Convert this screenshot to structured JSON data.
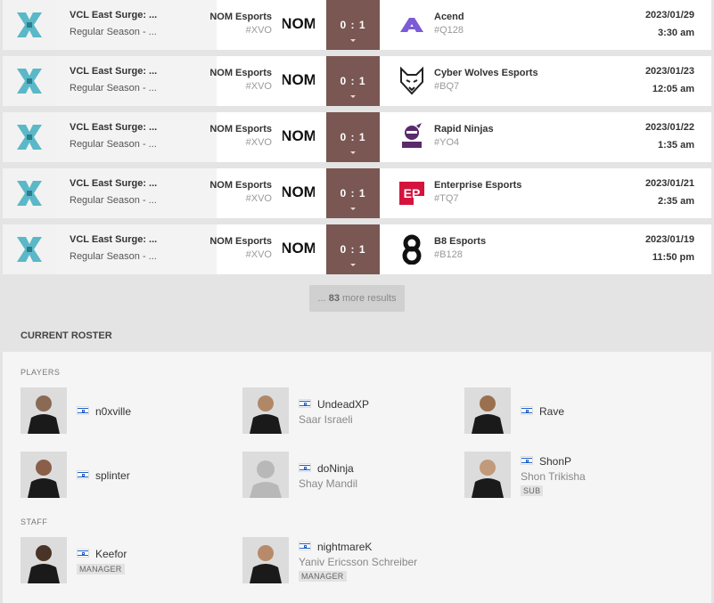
{
  "matches": [
    {
      "event": "VCL East Surge: ...",
      "stage": "Regular Season - ...",
      "team1": "NOM Esports",
      "team1_tag": "#XVO",
      "score": "0 : 1",
      "team2": "Acend",
      "team2_tag": "#Q128",
      "team2_logo": "acend-logo",
      "date": "2023/01/29",
      "time": "3:30 am"
    },
    {
      "event": "VCL East Surge: ...",
      "stage": "Regular Season - ...",
      "team1": "NOM Esports",
      "team1_tag": "#XVO",
      "score": "0 : 1",
      "team2": "Cyber Wolves Esports",
      "team2_tag": "#BQ7",
      "team2_logo": "wolf-logo",
      "date": "2023/01/23",
      "time": "12:05 am"
    },
    {
      "event": "VCL East Surge: ...",
      "stage": "Regular Season - ...",
      "team1": "NOM Esports",
      "team1_tag": "#XVO",
      "score": "0 : 1",
      "team2": "Rapid Ninjas",
      "team2_tag": "#YO4",
      "team2_logo": "ninja-logo",
      "date": "2023/01/22",
      "time": "1:35 am"
    },
    {
      "event": "VCL East Surge: ...",
      "stage": "Regular Season - ...",
      "team1": "NOM Esports",
      "team1_tag": "#XVO",
      "score": "0 : 1",
      "team2": "Enterprise Esports",
      "team2_tag": "#TQ7",
      "team2_logo": "ep-logo",
      "date": "2023/01/21",
      "time": "2:35 am"
    },
    {
      "event": "VCL East Surge: ...",
      "stage": "Regular Season - ...",
      "team1": "NOM Esports",
      "team1_tag": "#XVO",
      "score": "0 : 1",
      "team2": "B8 Esports",
      "team2_tag": "#B128",
      "team2_logo": "b8-logo",
      "date": "2023/01/19",
      "time": "11:50 pm"
    }
  ],
  "more_results": {
    "prefix": "... ",
    "count": "83",
    "suffix": " more results"
  },
  "roster": {
    "title": "CURRENT ROSTER",
    "players_label": "PLAYERS",
    "staff_label": "STAFF",
    "players": [
      {
        "nick": "n0xville",
        "real": "",
        "badge": ""
      },
      {
        "nick": "UndeadXP",
        "real": "Saar Israeli",
        "badge": ""
      },
      {
        "nick": "Rave",
        "real": "",
        "badge": ""
      },
      {
        "nick": "splinter",
        "real": "",
        "badge": ""
      },
      {
        "nick": "doNinja",
        "real": "Shay Mandil",
        "badge": ""
      },
      {
        "nick": "ShonP",
        "real": "Shon Trikisha",
        "badge": "SUB"
      }
    ],
    "staff": [
      {
        "nick": "Keefor",
        "real": "",
        "badge": "MANAGER"
      },
      {
        "nick": "nightmareK",
        "real": "Yaniv Ericsson Schreiber",
        "badge": "MANAGER"
      }
    ]
  },
  "colors": {
    "score_bg": "#7a5753",
    "acend": "#7b5bd6",
    "rapid": "#5a2a6a",
    "ep": "#d4143c"
  }
}
